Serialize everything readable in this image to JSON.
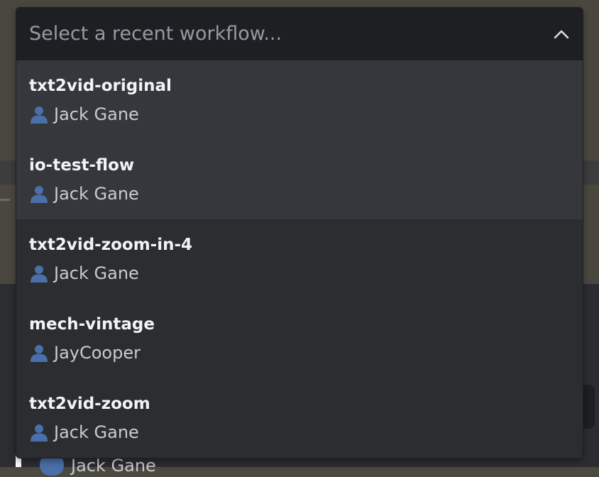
{
  "select": {
    "placeholder": "Select a recent workflow...",
    "expanded": true,
    "chevron_icon": "chevron-up-icon"
  },
  "options": [
    {
      "title": "txt2vid-original",
      "author": "Jack Gane",
      "icon": "user-icon",
      "focused": true
    },
    {
      "title": "io-test-flow",
      "author": "Jack Gane",
      "icon": "user-icon",
      "focused": true
    },
    {
      "title": "txt2vid-zoom-in-4",
      "author": "Jack Gane",
      "icon": "user-icon",
      "focused": false
    },
    {
      "title": "mech-vintage",
      "author": "JayCooper",
      "icon": "user-icon",
      "focused": false
    },
    {
      "title": "txt2vid-zoom",
      "author": "Jack Gane",
      "icon": "user-icon",
      "focused": false
    }
  ],
  "background": {
    "partial_author": "Jack Gane"
  },
  "colors": {
    "dropdown_bg": "#2b2d31",
    "header_bg": "#1e1f22",
    "focused_bg": "#35373c",
    "title_text": "#f2f3f5",
    "muted_text": "#949ba4",
    "user_icon": "#4b6fa8"
  }
}
